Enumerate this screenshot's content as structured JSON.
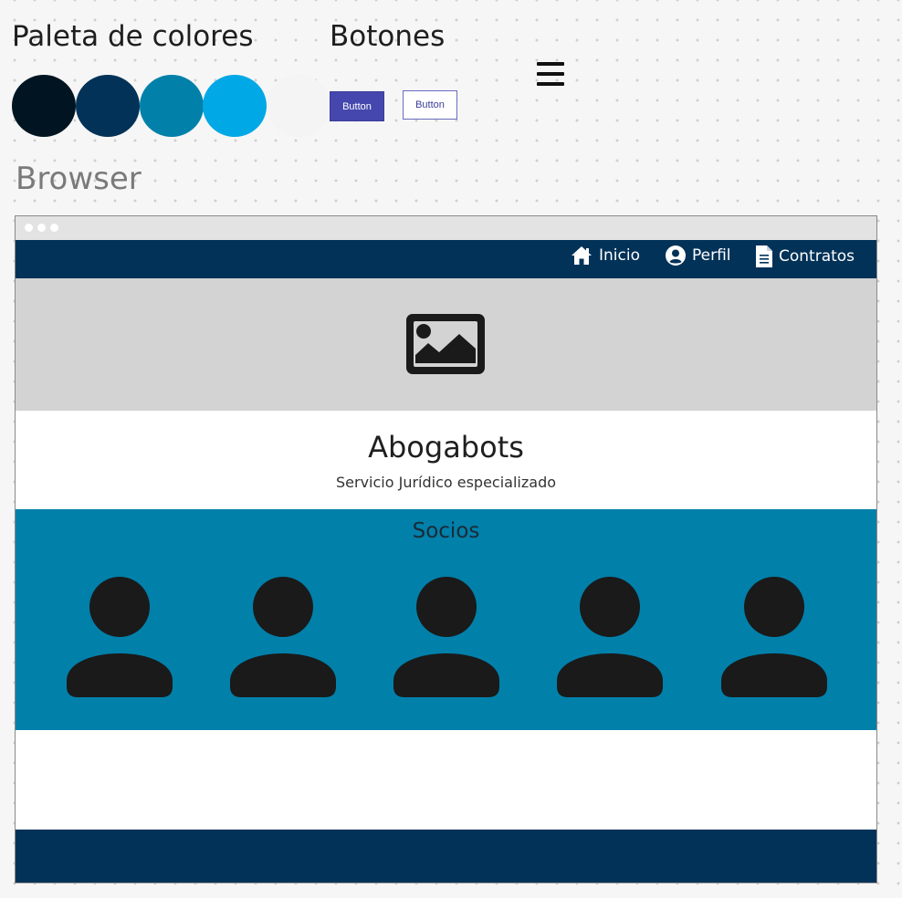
{
  "palette": {
    "title": "Paleta de colores",
    "swatches": [
      "#001521",
      "#023258",
      "#0180aa",
      "#00a8e6",
      "#f4f4f4"
    ]
  },
  "buttons": {
    "title": "Botones",
    "filled_label": "Button",
    "outline_label": "Button",
    "filled_color": "#4547ae"
  },
  "browser": {
    "title": "Browser",
    "nav": [
      {
        "label": "Inicio",
        "icon": "home-icon"
      },
      {
        "label": "Perfil",
        "icon": "user-circle-icon"
      },
      {
        "label": "Contratos",
        "icon": "document-icon"
      }
    ],
    "hero_icon": "image-placeholder-icon",
    "brand_name": "Abogabots",
    "brand_tagline": "Servicio Jurídico especializado",
    "partners_title": "Socios",
    "partners_count": 5,
    "colors": {
      "navbar": "#023258",
      "hero": "#d3d3d3",
      "partners": "#0180aa",
      "footer": "#023258"
    }
  }
}
